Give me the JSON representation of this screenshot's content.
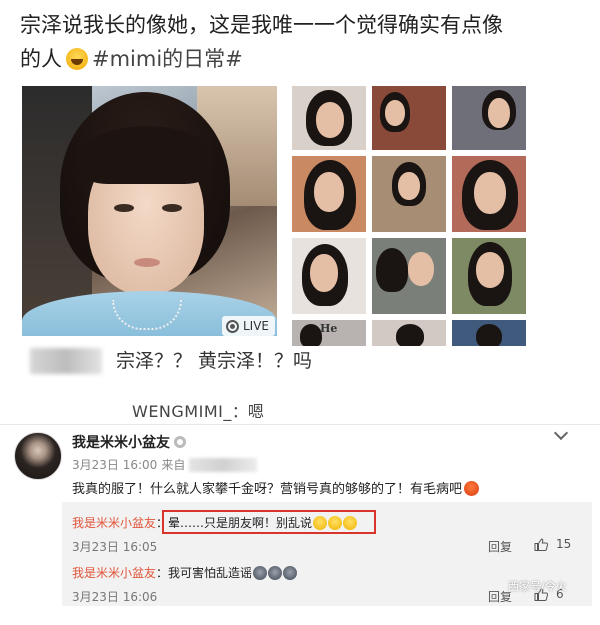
{
  "post": {
    "text_line1": "宗泽说我长的像她，这是我唯一一个觉得确实有点像",
    "text_line2_prefix": "的人",
    "text_line2_suffix": "#mimi的日常#",
    "emoji": "laughing-emoji"
  },
  "main_photo": {
    "live_label": "LIVE"
  },
  "thumbnail_grid": {
    "count": 12,
    "tag_text": "He"
  },
  "comment": {
    "text": "宗泽？？ 黄宗泽！？吗"
  },
  "reply": {
    "name": "WENGMIMI_",
    "text": "：嗯"
  },
  "weibo_comment": {
    "username": "我是米米小盆友",
    "date": "3月23日 16:00",
    "source_prefix": "来自",
    "text": "我真的服了！什么就人家攀千金呀？营销号真的够够的了！有毛病吧",
    "sub_replies": [
      {
        "name": "我是米米小盆友",
        "text": "：晕……只是朋友啊！别乱说",
        "date": "3月23日 16:05",
        "reply_label": "回复",
        "likes": "15",
        "highlighted": true
      },
      {
        "name": "我是米米小盆友",
        "text": "：我可害怕乱造谣",
        "date": "3月23日 16:06",
        "reply_label": "回复",
        "likes": "6",
        "highlighted": false
      }
    ]
  },
  "watermark": "西家号/令火",
  "colors": {
    "accent_name": "#e0553a",
    "highlight_border": "#d9342b",
    "sub_bg": "#f2f2f2"
  }
}
